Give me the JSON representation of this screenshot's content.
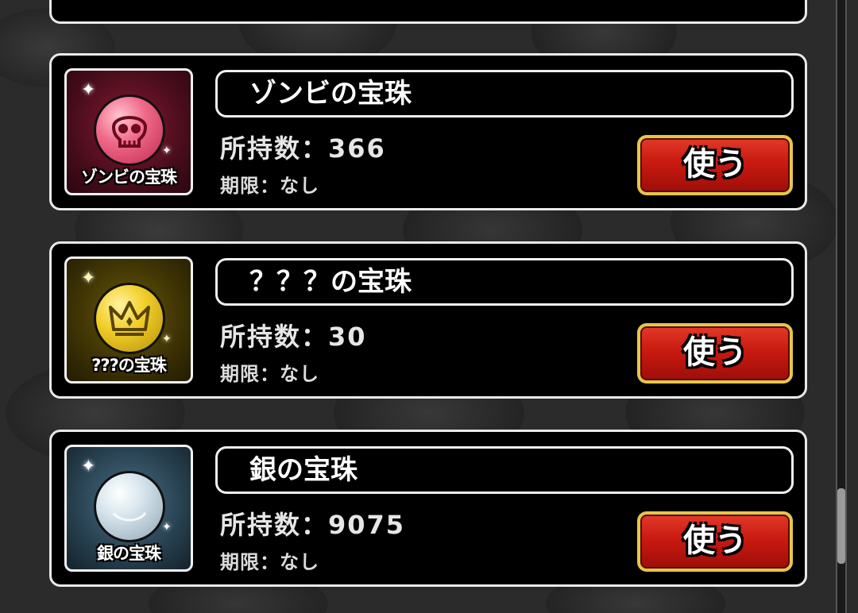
{
  "items": [
    {
      "name": "ゾンビの宝珠",
      "icon_label": "ゾンビの宝珠",
      "icon": "skull-orb-icon",
      "orb_color": "#e8476a",
      "count_text": "所持数：366",
      "expiry_text": "期限：なし",
      "use_label": "使う"
    },
    {
      "name": "？？？の宝珠",
      "icon_label": "???の宝珠",
      "icon": "crown-orb-icon",
      "orb_color": "#e5c21c",
      "count_text": "所持数：30",
      "expiry_text": "期限：なし",
      "use_label": "使う"
    },
    {
      "name": "銀の宝珠",
      "icon_label": "銀の宝珠",
      "icon": "silver-orb-icon",
      "orb_color": "#c9dbe6",
      "count_text": "所持数：9075",
      "expiry_text": "期限：なし",
      "use_label": "使う"
    }
  ],
  "colors": {
    "button_red": "#c81a10",
    "button_border": "#e3c74a",
    "card_border": "#e9e9e9"
  }
}
